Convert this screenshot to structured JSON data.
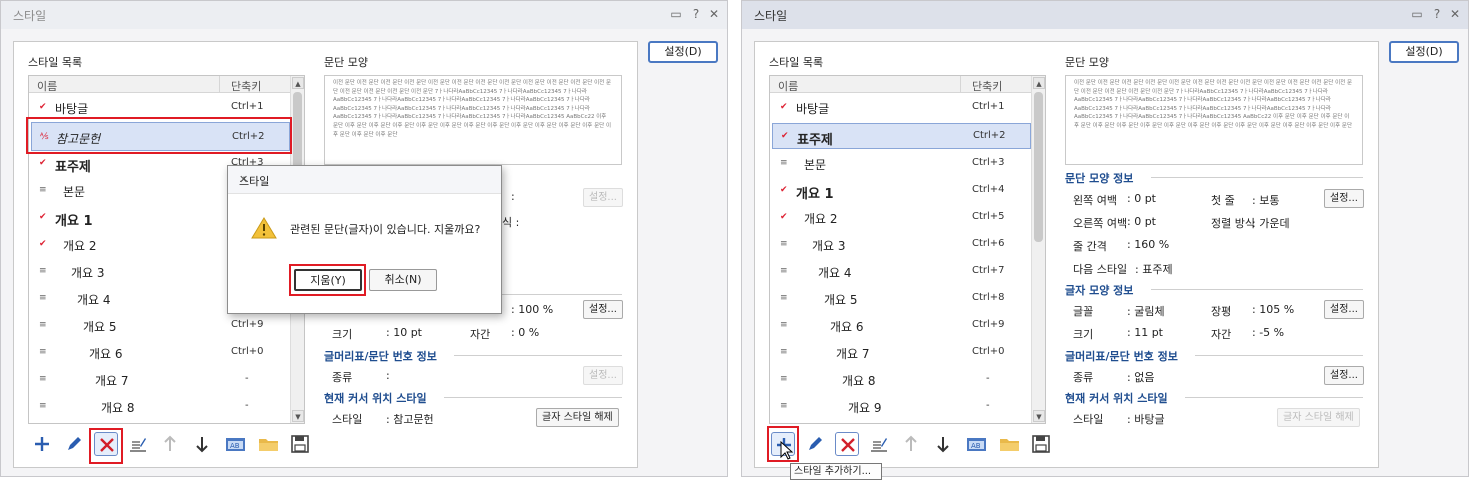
{
  "left": {
    "window_title": "스타일",
    "style_list_label": "스타일 목록",
    "col_name": "이름",
    "col_key": "단축키",
    "settings_button": "설정(D)",
    "para_shape_label": "문단 모양",
    "preview_text": "이전 문단 이전 문단 이전 문단 이전 문단 이전 문단 이전 문단 이전 문단 이전 문단 이전 문단 이전 문단 이전 문단 이전 문단 이전 문단 이전 문단 이전 문단 이전 문단 7ㅏ나다라AaBbCc12345 7ㅏ나다라AaBbCc12345 7ㅏ나다라AaBbCc12345 7ㅏ나다라AaBbCc12345 7ㅏ나다라AaBbCc12345 7ㅏ나다라AaBbCc12345 7ㅏ나다라AaBbCc12345 7ㅏ나다라AaBbCc12345 7ㅏ나다라AaBbCc12345 7ㅏ나다라AaBbCc12345 7ㅏ나다라AaBbCc12345 7ㅏ나다라AaBbCc12345 7ㅏ나다라AaBbCc12345 7ㅏ나다라AaBbCc12345 AaBbCc22 이후 문단 이후 문단 이후 문단 이후 문단 이후 문단 이후 문단 이후 문단 이후 문단 이후 문단 이후 문단 이후 문단 이후 문단 이후 문단 이후 문단 이후 문단",
    "rows": [
      {
        "name": "바탕글",
        "key": "Ctrl+1"
      },
      {
        "name": "참고문헌",
        "key": "Ctrl+2"
      },
      {
        "name": "표주제",
        "key": "Ctrl+3"
      },
      {
        "name": "본문",
        "key": ""
      },
      {
        "name": "개요 1",
        "key": ""
      },
      {
        "name": "개요 2",
        "key": ""
      },
      {
        "name": "개요 3",
        "key": ""
      },
      {
        "name": "개요 4",
        "key": ""
      },
      {
        "name": "개요 5",
        "key": "Ctrl+9"
      },
      {
        "name": "개요 6",
        "key": "Ctrl+0"
      },
      {
        "name": "개요 7",
        "key": "-"
      },
      {
        "name": "개요 8",
        "key": "-"
      }
    ],
    "colon": ":",
    "sm_settings": "설정...",
    "char_ratio_value": ": 100 %",
    "size_label": "크기",
    "size_value": ": 10 pt",
    "spacing_label": "자간",
    "spacing_value": ": 0 %",
    "bullet_section": "글머리표/문단 번호 정보",
    "kind_label": "종류",
    "cursor_section": "현재 커서 위치 스타일",
    "style_label": "스타일",
    "style_value": ": 참고문헌",
    "char_style_clear": "글자 스타일 해제",
    "partial_text": "식 :",
    "dialog": {
      "title": "스타일",
      "message": "관련된 문단(글자)이 있습니다. 지울까요?",
      "ok": "지움(Y)",
      "cancel": "취소(N)"
    }
  },
  "right": {
    "window_title": "스타일",
    "style_list_label": "스타일 목록",
    "col_name": "이름",
    "col_key": "단축키",
    "settings_button": "설정(D)",
    "para_shape_label": "문단 모양",
    "preview_text": "이전 문단 이전 문단 이전 문단 이전 문단 이전 문단 이전 문단 이전 문단 이전 문단 이전 문단 이전 문단 이전 문단 이전 문단 이전 문단 이전 문단 이전 문단 이전 문단 7ㅏ나다라AaBbCc12345 7ㅏ나다라AaBbCc12345 7ㅏ나다라AaBbCc12345 7ㅏ나다라AaBbCc12345 7ㅏ나다라AaBbCc12345 7ㅏ나다라AaBbCc12345 7ㅏ나다라AaBbCc12345 7ㅏ나다라AaBbCc12345 7ㅏ나다라AaBbCc12345 7ㅏ나다라AaBbCc12345 7ㅏ나다라AaBbCc12345 7ㅏ나다라AaBbCc12345 7ㅏ나다라AaBbCc12345 AaBbCc22 이후 문단 이후 문단 이후 문단 이후 문단 이후 문단 이후 문단 이후 문단 이후 문단 이후 문단 이후 문단 이후 문단 이후 문단 이후 문단 이후 문단 이후 문단",
    "rows": [
      {
        "name": "바탕글",
        "key": "Ctrl+1"
      },
      {
        "name": "표주제",
        "key": "Ctrl+2"
      },
      {
        "name": "본문",
        "key": "Ctrl+3"
      },
      {
        "name": "개요 1",
        "key": "Ctrl+4"
      },
      {
        "name": "개요 2",
        "key": "Ctrl+5"
      },
      {
        "name": "개요 3",
        "key": "Ctrl+6"
      },
      {
        "name": "개요 4",
        "key": "Ctrl+7"
      },
      {
        "name": "개요 5",
        "key": "Ctrl+8"
      },
      {
        "name": "개요 6",
        "key": "Ctrl+9"
      },
      {
        "name": "개요 7",
        "key": "Ctrl+0"
      },
      {
        "name": "개요 8",
        "key": "-"
      },
      {
        "name": "개요 9",
        "key": "-"
      }
    ],
    "para_info_section": "문단 모양 정보",
    "left_margin_label": "왼쪽 여백",
    "left_margin_value": ": 0 pt",
    "first_line_label": "첫 줄",
    "first_line_value": ": 보통",
    "right_margin_label": "오른쪽 여백",
    "right_margin_value": ": 0 pt",
    "align_label": "정렬 방식",
    "align_value": ": 가운데",
    "line_spacing_label": "줄 간격",
    "line_spacing_value": ": 160 %",
    "next_style_label": "다음 스타일",
    "next_style_value": ": 표주제",
    "char_info_section": "글자 모양 정보",
    "font_label": "글꼴",
    "font_value": ": 굴림체",
    "ratio_label": "장평",
    "ratio_value": ": 105 %",
    "size_label": "크기",
    "size_value": ": 11 pt",
    "spacing_label": "자간",
    "spacing_value": ": -5 %",
    "bullet_section": "글머리표/문단 번호 정보",
    "kind_label": "종류",
    "kind_value": ": 없음",
    "cursor_section": "현재 커서 위치 스타일",
    "style_label": "스타일",
    "style_value": ": 바탕글",
    "char_style_clear": "글자 스타일 해제",
    "sm_settings": "설정...",
    "tooltip": "스타일 추가하기..."
  }
}
